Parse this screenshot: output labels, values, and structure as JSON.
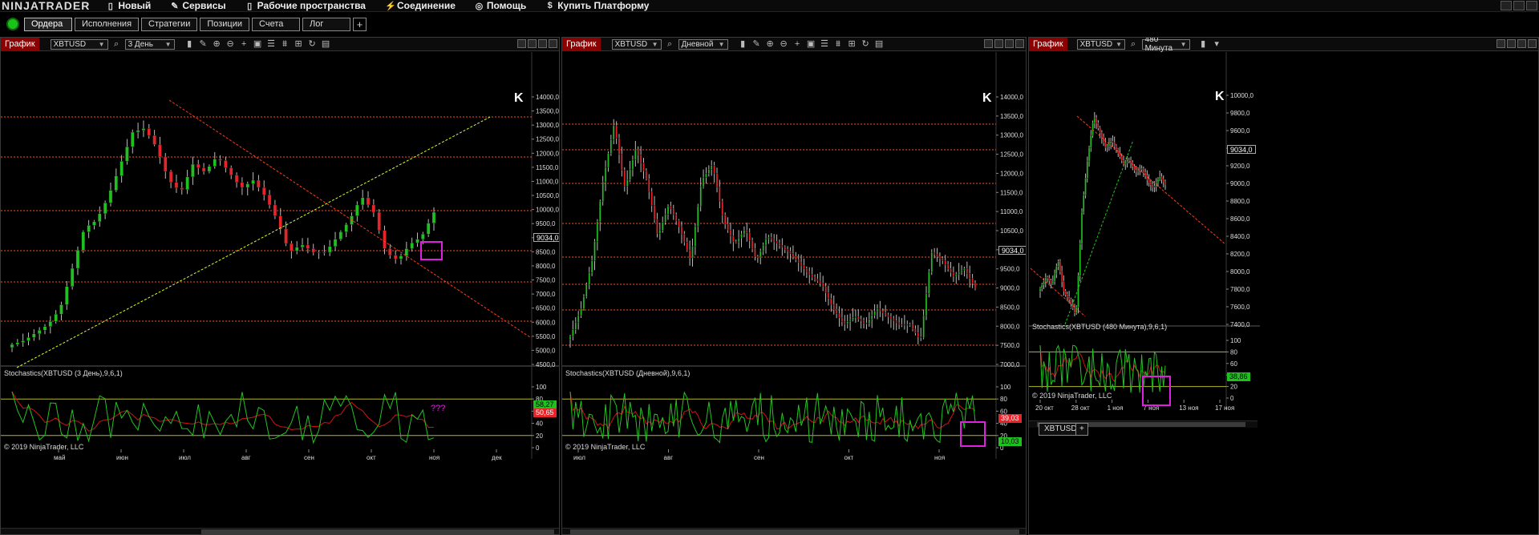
{
  "app": {
    "logo": "NINJATRADER"
  },
  "menu": [
    {
      "label": "Новый",
      "icon": "document-icon",
      "glyph": "▯"
    },
    {
      "label": "Сервисы",
      "icon": "tools-icon",
      "glyph": "✎"
    },
    {
      "label": "Рабочие пространства",
      "icon": "workspace-icon",
      "glyph": "▯"
    },
    {
      "label": "Соединение",
      "icon": "plug-icon",
      "glyph": "⚡"
    },
    {
      "label": "Помощь",
      "icon": "help-icon",
      "glyph": "◎"
    },
    {
      "label": "Купить Платформу",
      "icon": "dollar-icon",
      "glyph": "$"
    }
  ],
  "tabs": [
    "Ордера",
    "Исполнения",
    "Стратегии",
    "Позиции",
    "Счета",
    "Лог"
  ],
  "tab_add": "+",
  "colors": {
    "bull": "#1fc01f",
    "bear": "#e8242a",
    "hline": "#ff4a1a",
    "trend_down": "#ff3b1a",
    "trend_up": "#d7ff2a",
    "stoch_k": "#22c322",
    "stoch_d": "#d01414",
    "stoch_lvl": "#b5b52a",
    "box": "#e020e0",
    "title_bg": "#8b0000"
  },
  "panels": [
    {
      "title": "График",
      "instrument": "XBTUSD",
      "interval": "3 День",
      "indicator_label": "Stochastics(XBTUSD (3 День),9,6,1)",
      "copyright": "© 2019 NinjaTrader, LLC",
      "price_axis": [
        "14000,0",
        "13500,0",
        "13000,0",
        "12500,0",
        "12000,0",
        "11500,0",
        "11000,0",
        "10500,0",
        "10000,0",
        "9500,0",
        "9000,0",
        "8500,0",
        "8000,0",
        "7500,0",
        "7000,0",
        "6500,0",
        "6000,0",
        "5500,0",
        "5000,0",
        "4500,0"
      ],
      "current_price": "9034,0",
      "stoch_axis": [
        "100",
        "80",
        "60",
        "40",
        "20",
        "0"
      ],
      "stoch_k_value": "58,27",
      "stoch_d_value": "50,65",
      "time_axis": [
        "май",
        "июн",
        "июл",
        "авг",
        "сен",
        "окт",
        "ноя",
        "дек"
      ],
      "annotation": "???"
    },
    {
      "title": "График",
      "instrument": "XBTUSD",
      "interval": "Дневной",
      "indicator_label": "Stochastics(XBTUSD (Дневной),9,6,1)",
      "copyright": "© 2019 NinjaTrader, LLC",
      "price_axis": [
        "14000,0",
        "13500,0",
        "13000,0",
        "12500,0",
        "12000,0",
        "11500,0",
        "11000,0",
        "10500,0",
        "10000,0",
        "9500,0",
        "9000,0",
        "8500,0",
        "8000,0",
        "7500,0",
        "7000,0"
      ],
      "current_price": "9034,0",
      "stoch_axis": [
        "100",
        "80",
        "60",
        "40",
        "20",
        "0"
      ],
      "stoch_k_value": "10,03",
      "stoch_d_value": "39,03",
      "time_axis": [
        "июл",
        "авг",
        "сен",
        "окт",
        "ноя"
      ]
    },
    {
      "title": "График",
      "instrument": "XBTUSD",
      "interval": "480 Минута",
      "indicator_label": "Stochastics(XBTUSD (480 Минута),9,6,1)",
      "copyright": "© 2019 NinjaTrader, LLC",
      "price_axis": [
        "10000,0",
        "9800,0",
        "9600,0",
        "9400,0",
        "9200,0",
        "9000,0",
        "8800,0",
        "8600,0",
        "8400,0",
        "8200,0",
        "8000,0",
        "7800,0",
        "7600,0",
        "7400,0"
      ],
      "current_price": "9034,0",
      "stoch_axis": [
        "100",
        "80",
        "60",
        "40",
        "20",
        "0"
      ],
      "stoch_k_value": "38,86",
      "time_axis": [
        "20 окт",
        "28 окт",
        "1 ноя",
        "7 ноя",
        "13 ноя",
        "17 ноя"
      ],
      "instrument_tab": "XBTUSD",
      "instrument_tab_add": "+"
    }
  ]
}
